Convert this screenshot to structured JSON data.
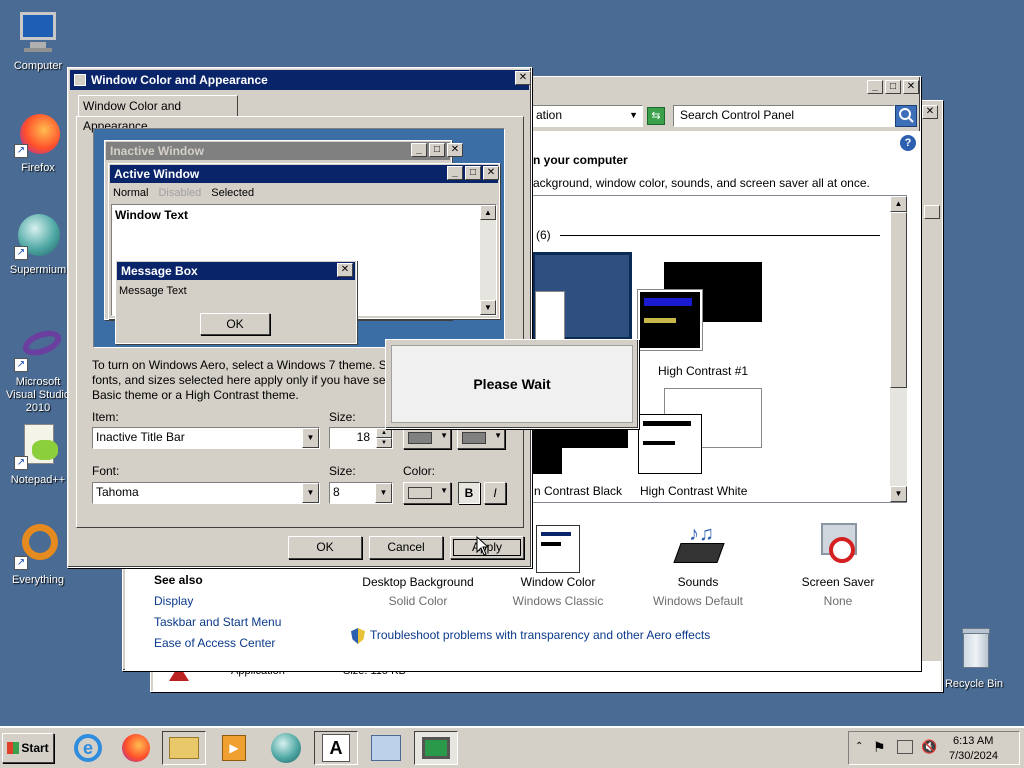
{
  "desktop": {
    "icons": [
      {
        "label": "Computer"
      },
      {
        "label": "Firefox"
      },
      {
        "label": "Supermium"
      },
      {
        "label": "Microsoft Visual Studio 2010"
      },
      {
        "label": "Notepad++"
      },
      {
        "label": "Everything"
      },
      {
        "label": "Recycle Bin"
      }
    ]
  },
  "control_panel": {
    "address_text": "ation",
    "search_placeholder": "Search Control Panel",
    "heading": "n your computer",
    "subheading": "ackground, window color, sounds, and screen saver all at once.",
    "group_count": "(6)",
    "themes": [
      {
        "label": "High Contrast #1"
      },
      {
        "label": "n Contrast Black"
      },
      {
        "label": "High Contrast White"
      }
    ],
    "bottom_items": [
      {
        "label": "Desktop Background",
        "sub": "Solid Color"
      },
      {
        "label": "Window Color",
        "sub": "Windows Classic"
      },
      {
        "label": "Sounds",
        "sub": "Windows Default"
      },
      {
        "label": "Screen Saver",
        "sub": "None"
      }
    ],
    "see_also_title": "See also",
    "see_also": [
      "Display",
      "Taskbar and Start Menu",
      "Ease of Access Center"
    ],
    "troubleshoot": "Troubleshoot problems with transparency and other Aero effects",
    "behind_row": {
      "name": "Application",
      "size": "Size: 115 KB"
    }
  },
  "dialog": {
    "title": "Window Color and Appearance",
    "tab": "Window Color and Appearance",
    "preview": {
      "inactive_title": "Inactive Window",
      "active_title": "Active Window",
      "menu_normal": "Normal",
      "menu_disabled": "Disabled",
      "menu_selected": "Selected",
      "window_text": "Window Text",
      "msgbox_title": "Message Box",
      "msgbox_text": "Message Text",
      "msgbox_ok": "OK"
    },
    "description_l1": "To turn on Windows Aero, select a Windows 7 theme.  S",
    "description_l2": "fonts, and sizes selected here apply only if you have sele",
    "description_l3": "Basic theme or a High Contrast theme.",
    "item_label": "Item:",
    "item_value": "Inactive Title Bar",
    "size_label": "Size:",
    "size_value": "18",
    "font_label": "Font:",
    "font_value": "Tahoma",
    "font_size_label": "Size:",
    "font_size_value": "8",
    "color_label": "Color:",
    "bold": "B",
    "italic": "I",
    "ok": "OK",
    "cancel": "Cancel",
    "apply": "Apply"
  },
  "please_wait": "Please Wait",
  "taskbar": {
    "start": "Start",
    "time": "6:13 AM",
    "date": "7/30/2024"
  }
}
